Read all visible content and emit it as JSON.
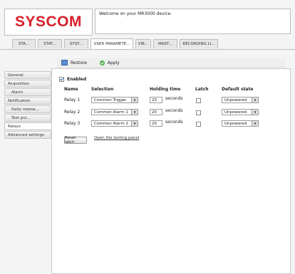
{
  "header": {
    "logo_text": "SYSCOM",
    "welcome_message": "Welcome on your MR3000 device."
  },
  "tabs": [
    {
      "label": "STA..."
    },
    {
      "label": "STAT..."
    },
    {
      "label": "SYST..."
    },
    {
      "label": "USER PARAMETE..."
    },
    {
      "label": "VIB..."
    },
    {
      "label": "MAST..."
    },
    {
      "label": "RECORDING LI..."
    }
  ],
  "active_tab": "USER PARAMETE...",
  "toolbar": {
    "restore_label": "Restore",
    "apply_label": "Apply"
  },
  "sidebar": {
    "items": [
      {
        "label": "General"
      },
      {
        "label": "Acquisition"
      },
      {
        "label": "Alarm"
      },
      {
        "label": "Notification"
      },
      {
        "label": "Daily messa..."
      },
      {
        "label": "Test pul..."
      },
      {
        "label": "Relays"
      },
      {
        "label": "Advanced settings"
      }
    ],
    "active": "Relays"
  },
  "relays": {
    "enabled_label": "Enabled",
    "enabled_checked": true,
    "columns": {
      "name": "Name",
      "selection": "Selection",
      "holding_time": "Holding time",
      "latch": "Latch",
      "default_state": "Default state"
    },
    "rows": [
      {
        "name": "Relay 1",
        "selection": "Common Trigger",
        "holding_time": "20",
        "unit": "seconds",
        "latch": false,
        "default_state": "Unpowered"
      },
      {
        "name": "Relay 2",
        "selection": "Common Alarm 1",
        "holding_time": "20",
        "unit": "seconds",
        "latch": false,
        "default_state": "Unpowered"
      },
      {
        "name": "Relay 3",
        "selection": "Common Alarm 2",
        "holding_time": "20",
        "unit": "seconds",
        "latch": false,
        "default_state": "Unpowered"
      }
    ],
    "reset_latch_label": "Reset latch",
    "testing_panel_link": "Open the testing panel"
  },
  "colors": {
    "logo": "#d8202a",
    "apply_icon": "#4ab04a",
    "restore_icon": "#5b8fd6"
  }
}
